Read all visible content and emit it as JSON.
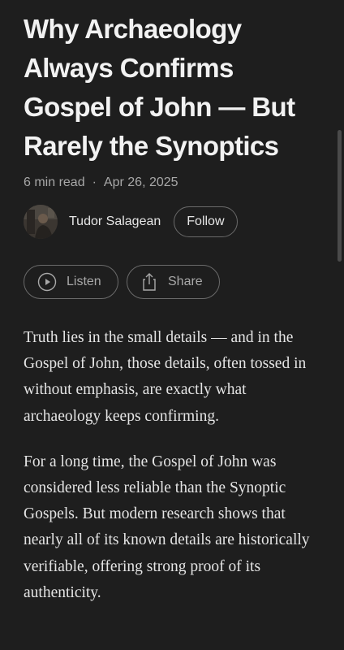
{
  "article": {
    "title": "Why Archaeology Always Confirms Gospel of John — But Rarely the Synoptics",
    "read_time": "6 min read",
    "separator": "·",
    "date": "Apr 26, 2025",
    "author": {
      "name": "Tudor Salagean",
      "follow_label": "Follow"
    },
    "actions": {
      "listen_label": "Listen",
      "share_label": "Share",
      "listen_icon": "play-circle-icon",
      "share_icon": "share-icon"
    },
    "paragraphs": [
      "Truth lies in the small details — and in the Gospel of John, those details, often tossed in without emphasis, are exactly what archaeology keeps confirming.",
      "For a long time, the Gospel of John was considered less reliable than the Synoptic Gospels. But modern research shows that nearly all of its known details are historically verifiable, offering strong proof of its authenticity."
    ]
  },
  "colors": {
    "background": "#1e1e1e",
    "text": "#e8e8e8",
    "muted": "#a8a8a8",
    "border": "#6a6a6a"
  }
}
